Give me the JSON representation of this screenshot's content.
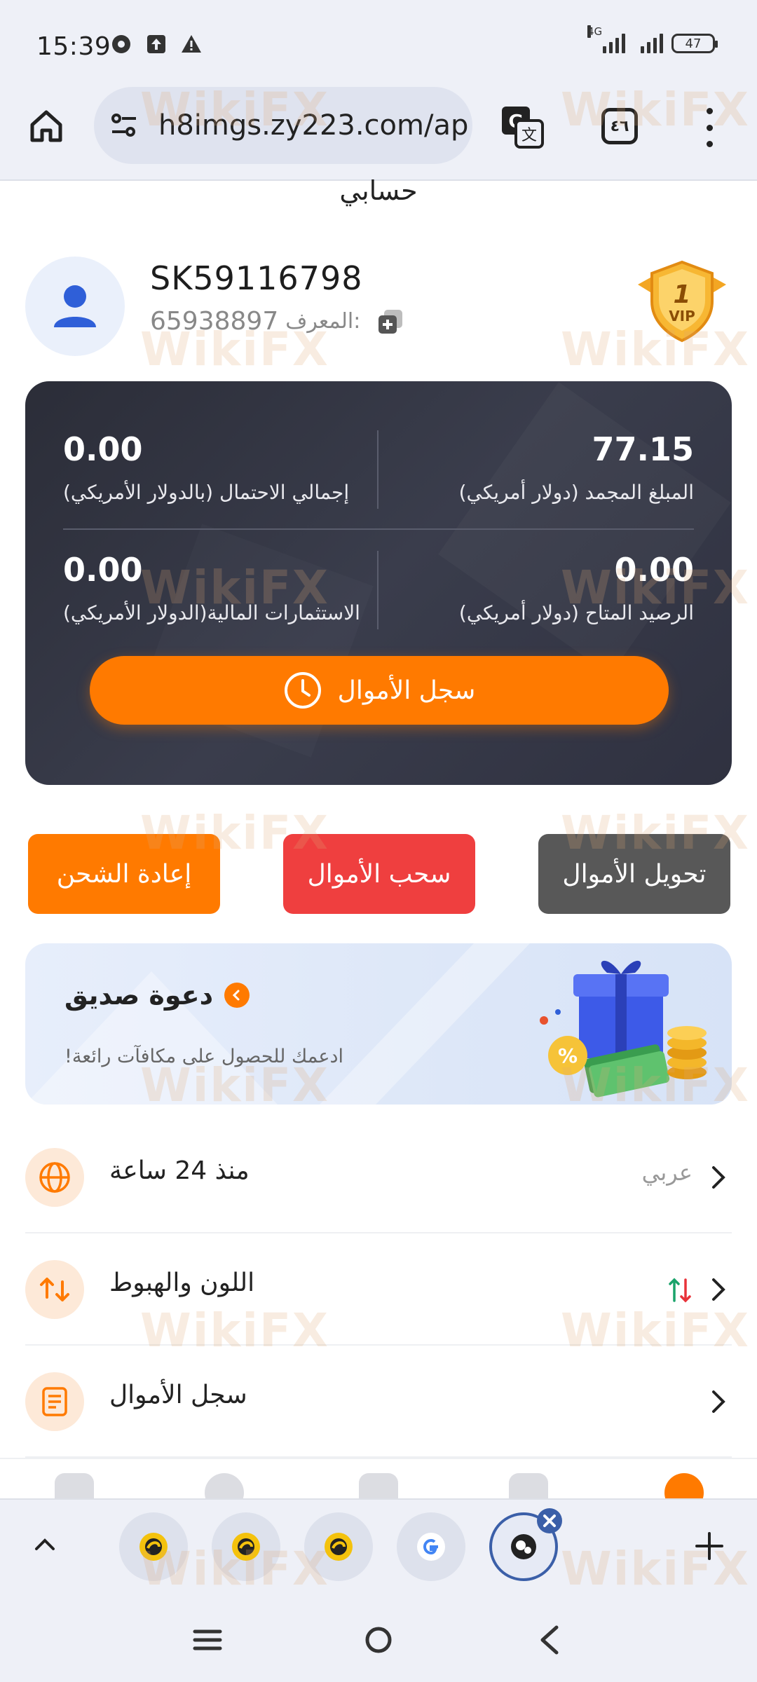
{
  "status_bar": {
    "time": "15:39",
    "network": "4G",
    "battery": "47",
    "icons": [
      "chrome-icon",
      "upload-icon",
      "warning-icon",
      "signal-icon",
      "signal-icon",
      "battery-icon"
    ]
  },
  "browser": {
    "url": "h8imgs.zy223.com/ap",
    "tab_count": "٤٦",
    "icons": [
      "home-icon",
      "site-settings-icon",
      "translate-icon",
      "tabs-icon",
      "more-menu-icon"
    ]
  },
  "page": {
    "title": "حسابي"
  },
  "profile": {
    "user_id": "SK59116798",
    "referrer_label": "المعرف:",
    "referrer_value": "65938897",
    "vip_level": "1",
    "vip_text": "VIP"
  },
  "assets": {
    "frozen_value": "77.15",
    "frozen_label": "المبلغ المجمد (دولار أمريكي)",
    "total_held_value": "0.00",
    "total_held_label": "إجمالي الاحتمال (بالدولار الأمريكي)",
    "available_value": "0.00",
    "available_label": "الرصيد المتاح (دولار أمريكي)",
    "investments_value": "0.00",
    "investments_label": "الاستثمارات المالية(الدولار الأمريكي)",
    "history_button": "سجل الأموال"
  },
  "actions": {
    "transfer": "تحويل الأموال",
    "withdraw": "سحب الأموال",
    "recharge": "إعادة الشحن",
    "colors": {
      "transfer": "#585858",
      "withdraw": "#ef3f3f",
      "recharge": "#ff7a00"
    }
  },
  "invite": {
    "title": "دعوة صديق",
    "subtitle": "!ادعمك للحصول على مكافآت رائعة"
  },
  "settings": [
    {
      "label": "منذ 24 ساعة",
      "value": "عربي",
      "icon": "globe-icon"
    },
    {
      "label": "اللون والهبوط",
      "value": "",
      "icon": "up-down-arrows-icon"
    },
    {
      "label": "سجل الأموال",
      "value": "",
      "icon": "document-icon"
    }
  ],
  "bottom_tabs": {
    "favicons": [
      "app-favicon",
      "app-favicon",
      "app-favicon",
      "google-favicon",
      "current-site-favicon"
    ]
  },
  "watermark": "WikiFX",
  "accent": "#ff7a00"
}
